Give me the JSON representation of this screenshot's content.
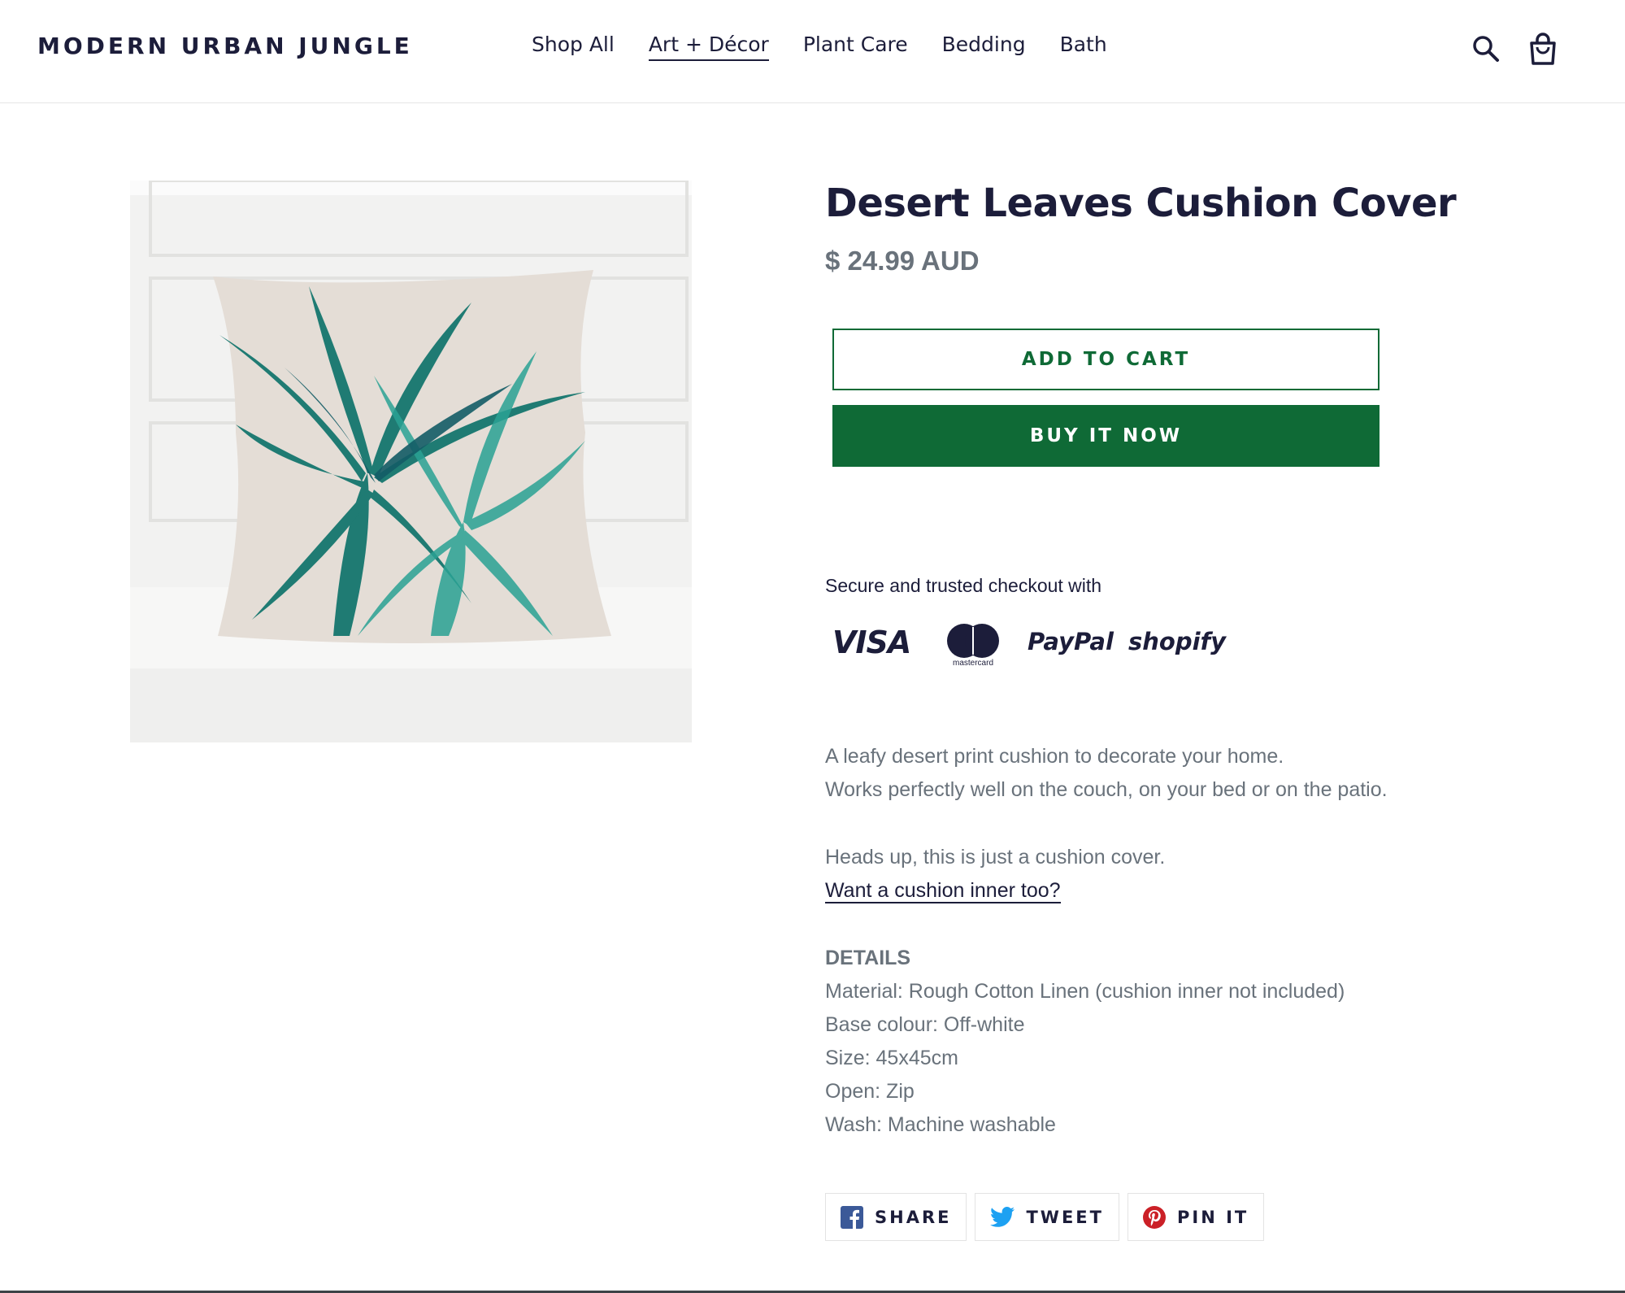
{
  "header": {
    "logo": "MODERN URBAN JUNGLE",
    "nav": [
      {
        "label": "Shop All",
        "active": false
      },
      {
        "label": "Art + Décor",
        "active": true
      },
      {
        "label": "Plant Care",
        "active": false
      },
      {
        "label": "Bedding",
        "active": false
      },
      {
        "label": "Bath",
        "active": false
      }
    ],
    "icons": {
      "search": "search-icon",
      "cart": "shopping-bag-icon"
    }
  },
  "product": {
    "title": "Desert Leaves Cushion Cover",
    "price": "$ 24.99 AUD",
    "add_to_cart_label": "ADD TO CART",
    "buy_now_label": "BUY IT NOW",
    "secure_text": "Secure and trusted checkout with",
    "payments": {
      "visa": "VISA",
      "mastercard": "mastercard",
      "paypal": "PayPal",
      "shopify": "shopify"
    },
    "description": {
      "line1": "A leafy desert print cushion to decorate your home.",
      "line2": "Works perfectly well on the couch, on your bed or on the patio.",
      "line3": "Heads up, this is just a cushion cover.",
      "link": "Want a cushion inner too?"
    },
    "details": {
      "heading": "DETAILS",
      "items": [
        "Material: Rough Cotton Linen (cushion inner not included)",
        "Base colour: Off-white",
        "Size: 45x45cm",
        "Open: Zip",
        "Wash: Machine washable"
      ]
    }
  },
  "share": [
    {
      "label": "SHARE",
      "icon": "facebook-icon"
    },
    {
      "label": "TWEET",
      "icon": "twitter-icon"
    },
    {
      "label": "PIN IT",
      "icon": "pinterest-icon"
    }
  ],
  "colors": {
    "brand_navy": "#1c1d3a",
    "accent_green": "#0f6a36",
    "text_grey": "#69727b"
  }
}
